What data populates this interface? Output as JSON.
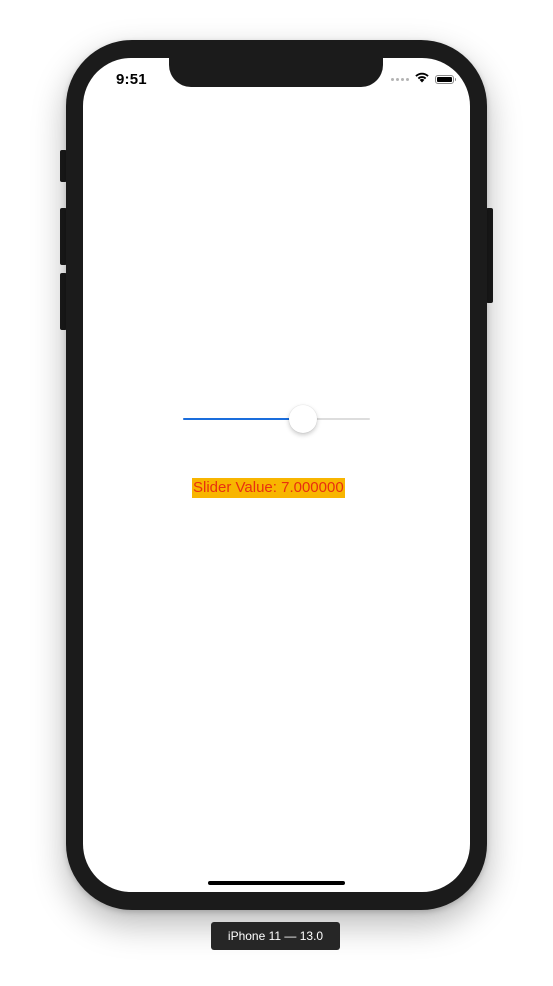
{
  "status_bar": {
    "time": "9:51",
    "icons": [
      "cellular-signal-icon",
      "wifi-icon",
      "battery-icon"
    ]
  },
  "slider": {
    "min": 0,
    "max": 11,
    "value": 7.0,
    "fill_fraction": 0.64,
    "min_track_color": "#1a6ddc",
    "max_track_color": "#dddddd"
  },
  "value_label": {
    "text": "Slider Value: 7.000000",
    "text_color": "#e8300f",
    "background_color": "#f8b500"
  },
  "device_caption": {
    "text": "iPhone 11 — 13.0"
  }
}
